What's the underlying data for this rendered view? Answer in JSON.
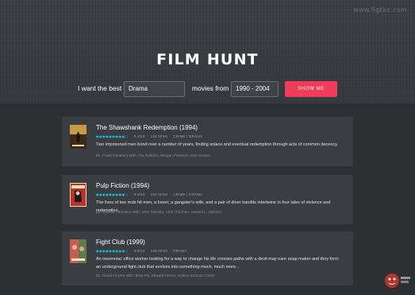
{
  "app": {
    "title": "FILM HUNT"
  },
  "search": {
    "label_prefix": "I want the best",
    "genre_value": "Drama",
    "label_middle": "movies from",
    "year_range_value": "1990 - 2004",
    "button_label": "SHOW ME"
  },
  "watermark": "www.9gtxx.com",
  "colors": {
    "accent": "#f23a5b",
    "stars": "#1fb5d4",
    "card_bg": "#3a3d42",
    "page_bg": "#2d2f32"
  },
  "movies": [
    {
      "title": "The Shawshank Redemption (1994)",
      "rating": "9.3/10",
      "runtime": "142 MINS",
      "genres": "CRIME | DRAMA",
      "description": "Two imprisoned men bond over a number of years, finding solace and eventual redemption through acts of common decency.",
      "cast": "Dir. Frank Darabont With: Tim Robbins, Morgan Freeman, Bob Gunton",
      "poster_icon": "poster-shawshank-icon"
    },
    {
      "title": "Pulp Fiction (1994)",
      "rating": "8.9/10",
      "runtime": "154 MINS",
      "genres": "CRIME | DRAMA",
      "description": "The lives of two mob hit men, a boxer, a gangster's wife, and a pair of diner bandits intertwine in four tales of violence and redemption.",
      "cast": "Dir. Quentin Tarantino With: John Travolta, Uma Thurman, Samuel L. Jackson",
      "poster_icon": "poster-pulp-fiction-icon"
    },
    {
      "title": "Fight Club (1999)",
      "rating": "8.8/10",
      "runtime": "139 MINS",
      "genres": "DRAMA",
      "description": "An insomniac office worker looking for a way to change his life crosses paths with a devil-may-care soap maker and they form an underground fight club that evolves into something much, much more...",
      "cast": "Dir. David Fincher With: Brad Pitt, Edward Norton, Helena Bonham Carter",
      "poster_icon": "poster-fight-club-icon"
    }
  ]
}
